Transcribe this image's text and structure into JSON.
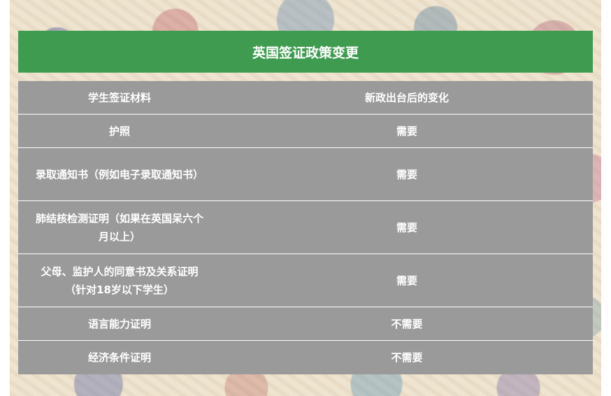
{
  "title": "英国签证政策变更",
  "table": {
    "headers": [
      "学生签证材料",
      "新政出台后的变化"
    ],
    "rows": [
      {
        "material": "护照",
        "change": "需要"
      },
      {
        "material": "录取通知书（例如电子录取通知书）",
        "change": "需要"
      },
      {
        "material": "肺结核检测证明（如果在英国呆六个月以上）",
        "change": "需要"
      },
      {
        "material": "父母、监护人的同意书及关系证明（针对18岁以下学生）",
        "change": "需要"
      },
      {
        "material": "语言能力证明",
        "change": "不需要"
      },
      {
        "material": "经济条件证明",
        "change": "不需要"
      }
    ]
  },
  "colors": {
    "title_bar": "#3f9b50",
    "table_bg": "#9a9a9a",
    "text": "#ffffff"
  }
}
